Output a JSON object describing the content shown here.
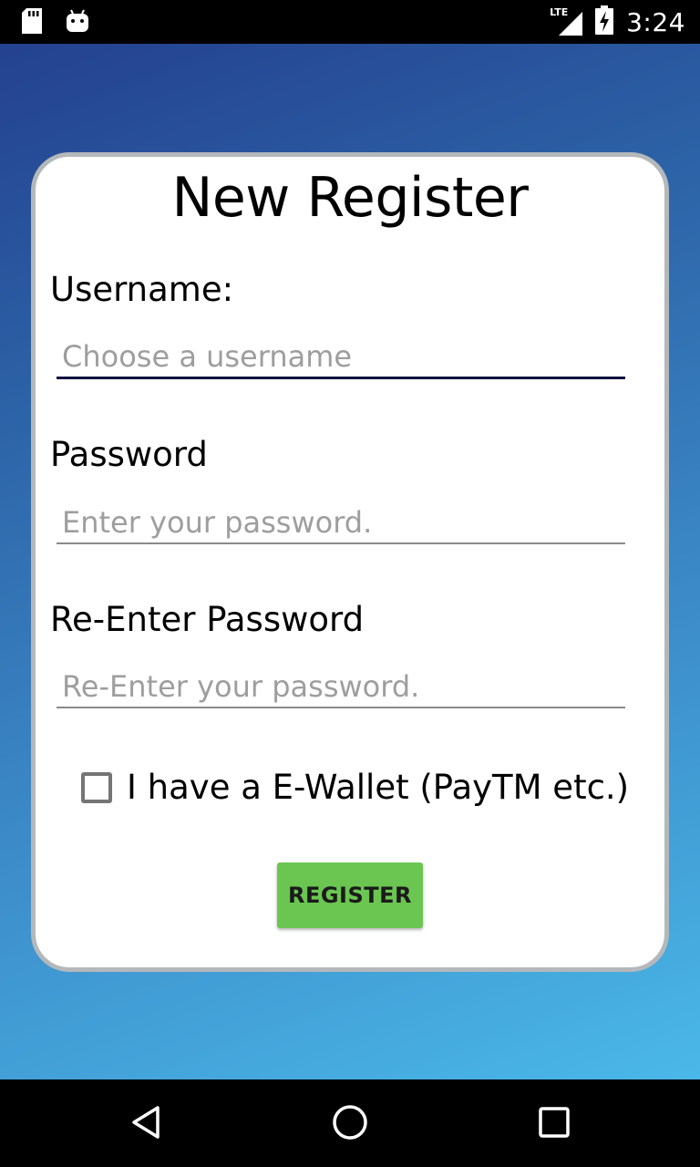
{
  "status_bar": {
    "time": "3:24",
    "network": "LTE",
    "icons": [
      "sd-card-icon",
      "android-icon",
      "signal-icon",
      "battery-charging-icon"
    ]
  },
  "form": {
    "title": "New Register",
    "username": {
      "label": "Username:",
      "placeholder": "Choose a username",
      "value": ""
    },
    "password": {
      "label": "Password",
      "placeholder": "Enter your password.",
      "value": ""
    },
    "reenter_password": {
      "label": "Re-Enter Password",
      "placeholder": "Re-Enter your password.",
      "value": ""
    },
    "ewallet": {
      "label": "I have a E-Wallet (PayTM etc.)",
      "checked": false
    },
    "register_label": "REGISTER"
  },
  "nav_bar": {
    "buttons": [
      "back-icon",
      "home-icon",
      "recents-icon"
    ]
  },
  "colors": {
    "gradient_start": "#24418f",
    "gradient_end": "#4ab8e8",
    "button": "#6ac651",
    "card_border": "#b4b8ba",
    "active_underline": "#121240"
  }
}
